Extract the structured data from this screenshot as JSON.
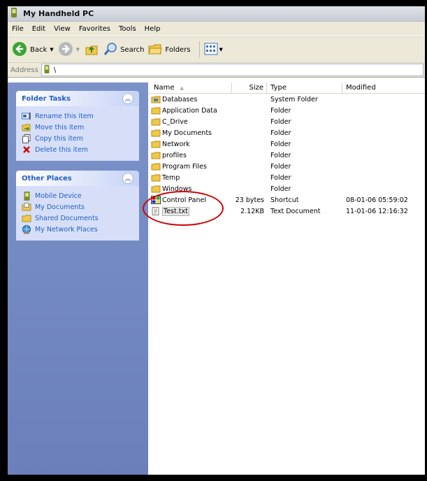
{
  "window": {
    "title": "My Handheld PC"
  },
  "menu": [
    "File",
    "Edit",
    "View",
    "Favorites",
    "Tools",
    "Help"
  ],
  "toolbar": {
    "back": "Back",
    "search": "Search",
    "folders": "Folders"
  },
  "address": {
    "label": "Address",
    "path": "\\"
  },
  "folder_tasks": {
    "title": "Folder Tasks",
    "items": [
      "Rename this item",
      "Move this item",
      "Copy this item",
      "Delete this item"
    ]
  },
  "other_places": {
    "title": "Other Places",
    "items": [
      "Mobile Device",
      "My Documents",
      "Shared Documents",
      "My Network Places"
    ]
  },
  "columns": {
    "name": "Name",
    "size": "Size",
    "type": "Type",
    "modified": "Modified"
  },
  "files": [
    {
      "name": "Databases",
      "size": "",
      "type": "System Folder",
      "modified": "",
      "icon": "system-folder-icon"
    },
    {
      "name": "Application Data",
      "size": "",
      "type": "Folder",
      "modified": "",
      "icon": "folder-icon"
    },
    {
      "name": "C_Drive",
      "size": "",
      "type": "Folder",
      "modified": "",
      "icon": "folder-icon"
    },
    {
      "name": "My Documents",
      "size": "",
      "type": "Folder",
      "modified": "",
      "icon": "folder-icon"
    },
    {
      "name": "Network",
      "size": "",
      "type": "Folder",
      "modified": "",
      "icon": "folder-icon"
    },
    {
      "name": "profiles",
      "size": "",
      "type": "Folder",
      "modified": "",
      "icon": "folder-icon"
    },
    {
      "name": "Program Files",
      "size": "",
      "type": "Folder",
      "modified": "",
      "icon": "folder-icon"
    },
    {
      "name": "Temp",
      "size": "",
      "type": "Folder",
      "modified": "",
      "icon": "folder-icon"
    },
    {
      "name": "Windows",
      "size": "",
      "type": "Folder",
      "modified": "",
      "icon": "folder-icon"
    },
    {
      "name": "Control Panel",
      "size": "23 bytes",
      "type": "Shortcut",
      "modified": "08-01-06 05:59:02",
      "icon": "shortcut-icon"
    },
    {
      "name": "Test.txt",
      "size": "2.12KB",
      "type": "Text Document",
      "modified": "11-01-06 12:16:32",
      "icon": "text-file-icon",
      "selected": true
    }
  ],
  "colors": {
    "accent": "#215dc6",
    "pane": "#7b92c9",
    "highlight_ring": "#d10000"
  }
}
